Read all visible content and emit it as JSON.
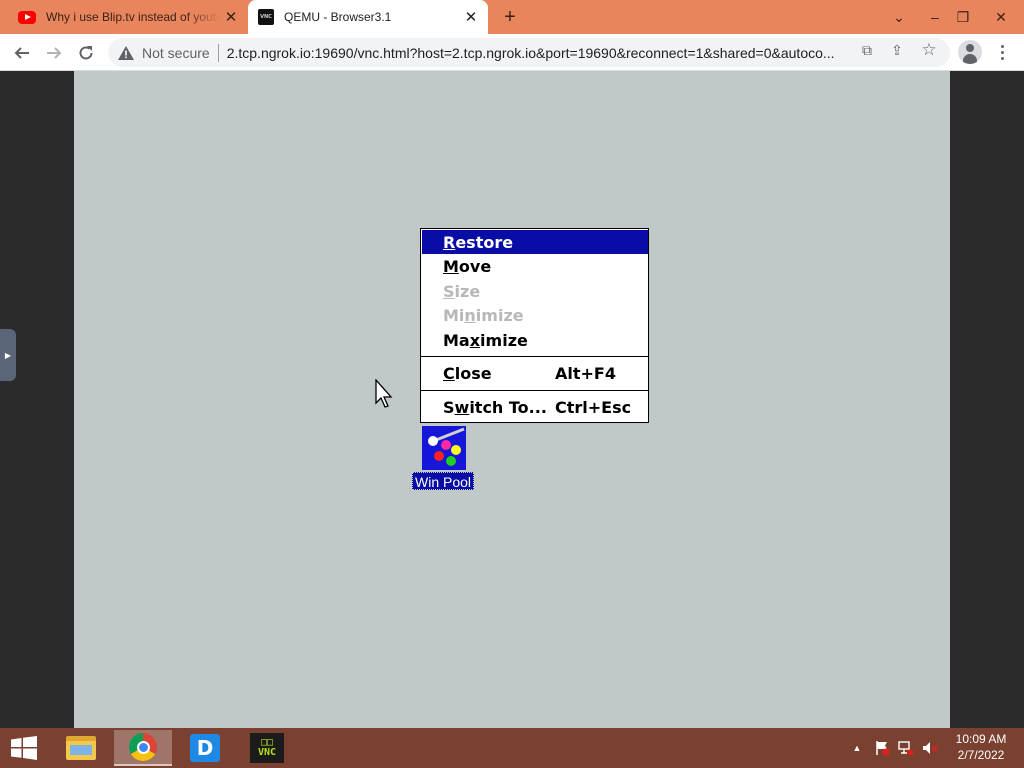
{
  "browser": {
    "tabs": [
      {
        "title": "Why i use Blip.tv instead of youtube",
        "favicon": "youtube-icon",
        "active": false
      },
      {
        "title": "QEMU - Browser3.1",
        "favicon": "vnc-icon",
        "favicon_text": "VNC",
        "active": true
      }
    ],
    "address_bar": {
      "security_label": "Not secure",
      "url": "2.tcp.ngrok.io:19690/vnc.html?host=2.tcp.ngrok.io&port=19690&reconnect=1&shared=0&autoco..."
    },
    "accent_color": "#e8855c"
  },
  "guest": {
    "desktop_color": "#c0c8c8",
    "system_menu": {
      "items": [
        {
          "pre": "",
          "u": "R",
          "post": "estore",
          "shortcut": "",
          "state": "selected"
        },
        {
          "pre": "",
          "u": "M",
          "post": "ove",
          "shortcut": "",
          "state": "enabled"
        },
        {
          "pre": "",
          "u": "S",
          "post": "ize",
          "shortcut": "",
          "state": "disabled"
        },
        {
          "pre": "Mi",
          "u": "n",
          "post": "imize",
          "shortcut": "",
          "state": "disabled"
        },
        {
          "pre": "Ma",
          "u": "x",
          "post": "imize",
          "shortcut": "",
          "state": "enabled"
        },
        {
          "pre": "",
          "u": "C",
          "post": "lose",
          "shortcut": "Alt+F4",
          "state": "enabled"
        },
        {
          "pre": "S",
          "u": "w",
          "post": "itch To...",
          "shortcut": "Ctrl+Esc",
          "state": "enabled"
        }
      ],
      "selection_color": "#0a0ca6"
    },
    "minimized_icon": {
      "label": "Win Pool",
      "icon": "billiards-icon"
    }
  },
  "taskbar": {
    "apps": [
      {
        "name": "file-explorer-icon"
      },
      {
        "name": "chrome-icon"
      },
      {
        "name": "d-app-icon",
        "glyph": "D"
      },
      {
        "name": "vnc-viewer-icon",
        "glyph_top": "□□",
        "glyph_bottom": "VNC"
      }
    ],
    "clock": {
      "time": "10:09 AM",
      "date": "2/7/2022"
    }
  }
}
